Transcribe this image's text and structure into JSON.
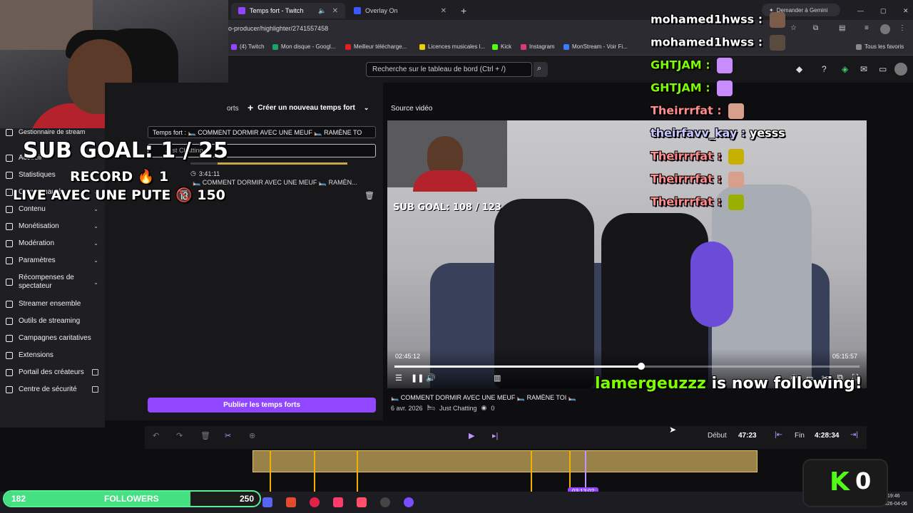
{
  "browser": {
    "tabs": [
      {
        "label": "Temps fort - Twitch",
        "active": true
      },
      {
        "label": "Overlay On",
        "active": false
      }
    ],
    "url": "o-producer/highlighter/2741557458",
    "gemini": "Demander à Gemini",
    "bookmarks": [
      "(4) Twitch",
      "Mon disque - Googl...",
      "Meilleur télécharge...",
      "Licences musicales l...",
      "Kick",
      "Instagram",
      "MonStream - Voir Fi...",
      "Tous les favoris"
    ]
  },
  "dashboard": {
    "search_placeholder": "Recherche sur le tableau de bord (Ctrl + /)"
  },
  "sidebar": {
    "items": [
      {
        "label": "Gestionnaire de stream",
        "chevron": false
      },
      {
        "label": "Accueil",
        "chevron": false
      },
      {
        "label": "Statistiques",
        "chevron": false
      },
      {
        "label": "Communauté",
        "chevron": true
      },
      {
        "label": "Contenu",
        "chevron": true
      },
      {
        "label": "Monétisation",
        "chevron": true
      },
      {
        "label": "Modération",
        "chevron": true
      },
      {
        "label": "Paramètres",
        "chevron": true
      },
      {
        "label": "Récompenses de spectateur",
        "chevron": true
      },
      {
        "label": "Streamer ensemble",
        "chevron": false
      },
      {
        "label": "Outils de streaming",
        "chevron": false
      },
      {
        "label": "Campagnes caritatives",
        "chevron": false
      },
      {
        "label": "Extensions",
        "chevron": false
      },
      {
        "label": "Portail des créateurs",
        "external": true
      },
      {
        "label": "Centre de sécurité",
        "external": true
      }
    ]
  },
  "overlay": {
    "sub_goal": "SUB GOAL: 1 / 25",
    "record": "RECORD 🔥 1",
    "live_line": "LIVE AVEC UNE PUTE 🔞 150"
  },
  "highlights": {
    "tab_partial": "orts",
    "create_label": "Créer un nouveau temps fort",
    "title_field": "Temps fort : 🛏️ COMMENT DORMIR AVEC UNE MEUF 🛏️ RAMÈNE TO",
    "category": "Just Chatting",
    "duration": "3:41:11",
    "item_title": "🛏️ COMMENT DORMIR AVEC UNE MEUF 🛏️ RAMÈN...",
    "publish_label": "Publier les temps forts"
  },
  "video": {
    "source_label": "Source vidéo",
    "current_time": "02:45:12",
    "end_time": "05:15:57",
    "progress": 0.53,
    "stream_sub_goal": "SUB GOAL: 108 / 123",
    "title": "🛏️ COMMENT DORMIR AVEC UNE MEUF 🛏️ RAMÈNE TOI 🛏️",
    "date": "6 avr. 2026",
    "category": "Just Chatting",
    "views": "0"
  },
  "chat": [
    {
      "user": "mohamed1hwss",
      "color": "#ffffff",
      "msg": "",
      "emote": "#7b5c4a"
    },
    {
      "user": "mohamed1hwss",
      "color": "#ffffff",
      "msg": "",
      "emote": "#5b4a3e"
    },
    {
      "user": "GHTJAM",
      "color": "#7cfc00",
      "msg": "",
      "emote": "#c98cff"
    },
    {
      "user": "GHTJAM",
      "color": "#7cfc00",
      "msg": "",
      "emote": "#c98cff"
    },
    {
      "user": "Theirrrfat",
      "color": "#ff8c8c",
      "msg": "",
      "emote": "#d8a08a"
    },
    {
      "user": "theirfavv_kay",
      "color": "#c9c9ff",
      "msg": "yesss",
      "emote": ""
    },
    {
      "user": "Theirrrfat",
      "color": "#ff8c8c",
      "msg": "",
      "emote": "#c8b000"
    },
    {
      "user": "Theirrrfat",
      "color": "#ff8c8c",
      "msg": "",
      "emote": "#d8a08a"
    },
    {
      "user": "Theirrrfat",
      "color": "#ff8c8c",
      "msg": "",
      "emote": "#9ab000"
    }
  ],
  "follow_alert": {
    "user": "lamergeuzzz",
    "text": "is now following!"
  },
  "timeline": {
    "start_label": "Début",
    "start_value": "47:23",
    "end_label": "Fin",
    "end_value": "4:28:34",
    "cursor_time": "03:13:02"
  },
  "followers_bar": {
    "count": "182",
    "label": "FOLLOWERS",
    "goal": "250",
    "progress": 0.728
  },
  "k_counter": {
    "letter": "K",
    "value": "0"
  },
  "clock": {
    "time": "19:46",
    "date": "2026-04-06"
  },
  "colors": {
    "accent": "#9147ff",
    "follow_green": "#58f096",
    "chat_green": "#7cfc00"
  }
}
